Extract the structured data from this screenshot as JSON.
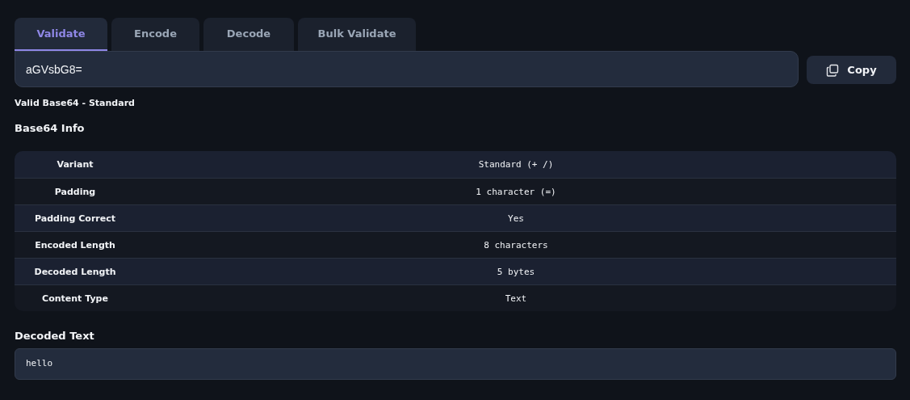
{
  "tabs": [
    {
      "label": "Validate",
      "selected": true
    },
    {
      "label": "Encode",
      "selected": false
    },
    {
      "label": "Decode",
      "selected": false
    },
    {
      "label": "Bulk Validate",
      "selected": false
    }
  ],
  "input": {
    "value": "aGVsbG8="
  },
  "copy_button": {
    "label": "Copy"
  },
  "status": "Valid Base64 - Standard",
  "info": {
    "heading": "Base64 Info",
    "rows": [
      {
        "label": "Variant",
        "value": "Standard (+ /)"
      },
      {
        "label": "Padding",
        "value": "1 character (=)"
      },
      {
        "label": "Padding Correct",
        "value": "Yes"
      },
      {
        "label": "Encoded Length",
        "value": "8 characters"
      },
      {
        "label": "Decoded Length",
        "value": "5 bytes"
      },
      {
        "label": "Content Type",
        "value": "Text"
      }
    ]
  },
  "decoded": {
    "heading": "Decoded Text",
    "value": "hello"
  }
}
